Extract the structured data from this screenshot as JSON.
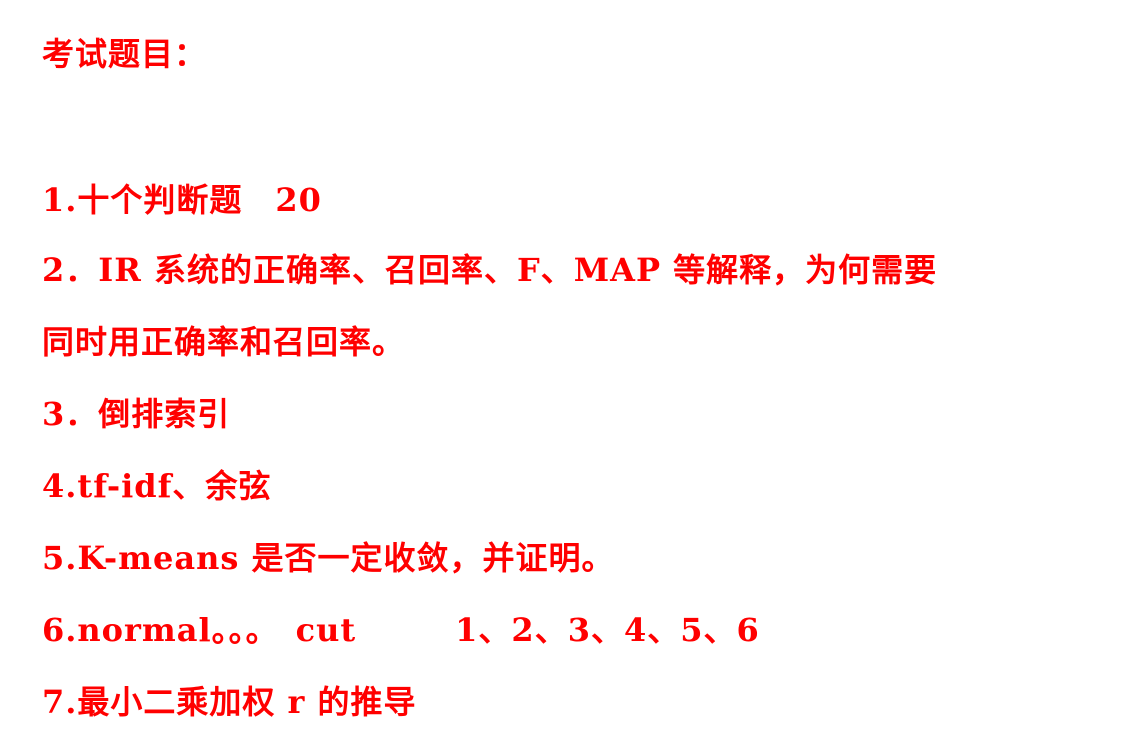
{
  "heading": "考试题目：",
  "items": [
    "1.十个判断题　20",
    "2．IR 系统的正确率、召回率、F、MAP 等解释，为何需要",
    "同时用正确率和召回率。",
    "3．倒排索引",
    "4.tf-idf、余弦",
    "5.K-means 是否一定收敛，并证明。",
    "6.normal。。。　cut　　　1、2、3、4、5、6",
    "7.最小二乘加权 r 的推导"
  ],
  "colors": {
    "text": "#ff0000",
    "background": "#ffffff"
  }
}
